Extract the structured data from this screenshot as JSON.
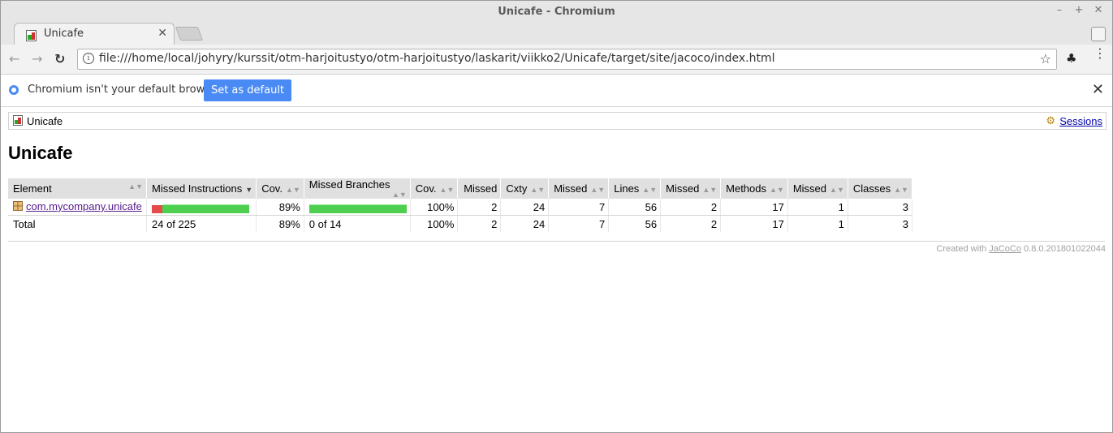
{
  "window": {
    "title": "Unicafe - Chromium"
  },
  "tabs": [
    {
      "title": "Unicafe"
    }
  ],
  "omnibox": {
    "url": "file:///home/local/johyry/kurssit/otm-harjoitustyo/otm-harjoitustyo/laskarit/viikko2/Unicafe/target/site/jacoco/index.html"
  },
  "infobar": {
    "message": "Chromium isn't your default browser.",
    "button": "Set as default"
  },
  "breadcrumb": {
    "current": "Unicafe",
    "sessions": "Sessions"
  },
  "page": {
    "heading": "Unicafe"
  },
  "table": {
    "headers": [
      "Element",
      "Missed Instructions",
      "Cov.",
      "Missed Branches",
      "Cov.",
      "Missed",
      "Cxty",
      "Missed",
      "Lines",
      "Missed",
      "Methods",
      "Missed",
      "Classes"
    ],
    "rows": [
      {
        "element": "com.mycompany.unicafe",
        "instr_missed_fraction": 0.11,
        "instr_cov": "89%",
        "branch_missed_fraction": 0.0,
        "branch_cov": "100%",
        "missed_cxty": "2",
        "cxty": "24",
        "missed_lines": "7",
        "lines": "56",
        "missed_methods": "2",
        "methods": "17",
        "missed_classes": "1",
        "classes": "3"
      }
    ],
    "total": {
      "label": "Total",
      "instr": "24 of 225",
      "instr_cov": "89%",
      "branch": "0 of 14",
      "branch_cov": "100%",
      "missed_cxty": "2",
      "cxty": "24",
      "missed_lines": "7",
      "lines": "56",
      "missed_methods": "2",
      "methods": "17",
      "missed_classes": "1",
      "classes": "3"
    }
  },
  "footer": {
    "prefix": "Created with ",
    "link": "JaCoCo",
    "version": " 0.8.0.201801022044"
  },
  "colors": {
    "accent": "#4a8af4",
    "bar_red": "#e64b4b",
    "bar_green": "#4fcf4f"
  }
}
